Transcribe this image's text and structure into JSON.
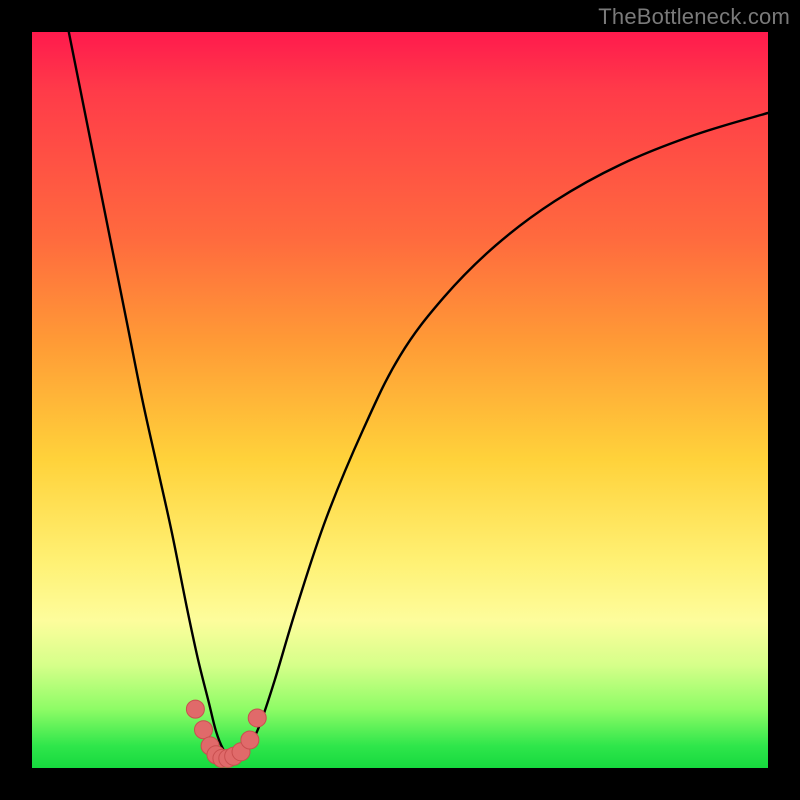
{
  "watermark": {
    "text": "TheBottleneck.com"
  },
  "colors": {
    "curve_stroke": "#000000",
    "marker_fill": "#e06a6a",
    "marker_stroke": "#c94f4f"
  },
  "chart_data": {
    "type": "line",
    "title": "",
    "xlabel": "",
    "ylabel": "",
    "xlim": [
      0,
      100
    ],
    "ylim": [
      0,
      100
    ],
    "grid": false,
    "legend": false,
    "series": [
      {
        "name": "bottleneck-curve",
        "x": [
          5,
          7,
          9,
          11,
          13,
          15,
          17,
          19,
          21,
          22.5,
          24,
          25,
          26,
          27,
          28,
          29.5,
          31,
          33,
          36,
          40,
          45,
          50,
          56,
          63,
          71,
          80,
          90,
          100
        ],
        "y": [
          100,
          90,
          80,
          70,
          60,
          50,
          41,
          32,
          22,
          15,
          9,
          5,
          2.5,
          1.3,
          1.8,
          3,
          6,
          12,
          22,
          34,
          46,
          56,
          64,
          71,
          77,
          82,
          86,
          89
        ]
      }
    ],
    "markers": {
      "name": "highlighted-points",
      "x": [
        22.2,
        23.3,
        24.2,
        25.0,
        25.8,
        26.6,
        27.4,
        28.4,
        29.6,
        30.6
      ],
      "y": [
        8.0,
        5.2,
        3.0,
        1.8,
        1.3,
        1.3,
        1.6,
        2.2,
        3.8,
        6.8
      ]
    }
  }
}
